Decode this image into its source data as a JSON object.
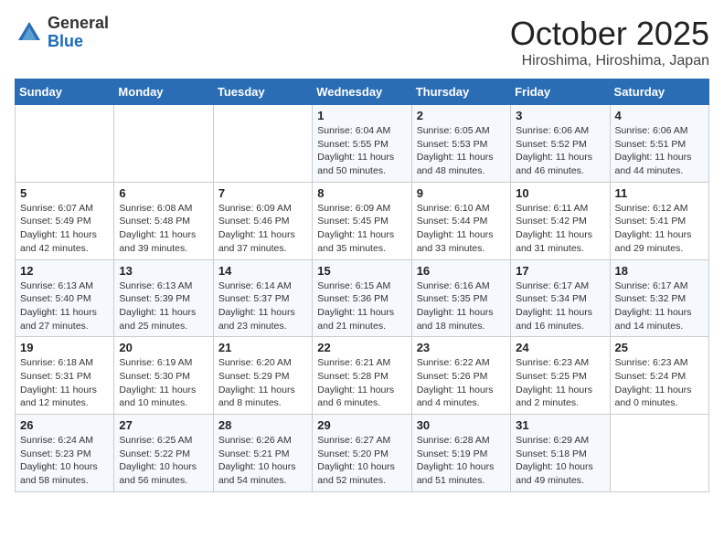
{
  "header": {
    "logo_general": "General",
    "logo_blue": "Blue",
    "month": "October 2025",
    "location": "Hiroshima, Hiroshima, Japan"
  },
  "weekdays": [
    "Sunday",
    "Monday",
    "Tuesday",
    "Wednesday",
    "Thursday",
    "Friday",
    "Saturday"
  ],
  "weeks": [
    [
      {
        "day": "",
        "text": ""
      },
      {
        "day": "",
        "text": ""
      },
      {
        "day": "",
        "text": ""
      },
      {
        "day": "1",
        "text": "Sunrise: 6:04 AM\nSunset: 5:55 PM\nDaylight: 11 hours\nand 50 minutes."
      },
      {
        "day": "2",
        "text": "Sunrise: 6:05 AM\nSunset: 5:53 PM\nDaylight: 11 hours\nand 48 minutes."
      },
      {
        "day": "3",
        "text": "Sunrise: 6:06 AM\nSunset: 5:52 PM\nDaylight: 11 hours\nand 46 minutes."
      },
      {
        "day": "4",
        "text": "Sunrise: 6:06 AM\nSunset: 5:51 PM\nDaylight: 11 hours\nand 44 minutes."
      }
    ],
    [
      {
        "day": "5",
        "text": "Sunrise: 6:07 AM\nSunset: 5:49 PM\nDaylight: 11 hours\nand 42 minutes."
      },
      {
        "day": "6",
        "text": "Sunrise: 6:08 AM\nSunset: 5:48 PM\nDaylight: 11 hours\nand 39 minutes."
      },
      {
        "day": "7",
        "text": "Sunrise: 6:09 AM\nSunset: 5:46 PM\nDaylight: 11 hours\nand 37 minutes."
      },
      {
        "day": "8",
        "text": "Sunrise: 6:09 AM\nSunset: 5:45 PM\nDaylight: 11 hours\nand 35 minutes."
      },
      {
        "day": "9",
        "text": "Sunrise: 6:10 AM\nSunset: 5:44 PM\nDaylight: 11 hours\nand 33 minutes."
      },
      {
        "day": "10",
        "text": "Sunrise: 6:11 AM\nSunset: 5:42 PM\nDaylight: 11 hours\nand 31 minutes."
      },
      {
        "day": "11",
        "text": "Sunrise: 6:12 AM\nSunset: 5:41 PM\nDaylight: 11 hours\nand 29 minutes."
      }
    ],
    [
      {
        "day": "12",
        "text": "Sunrise: 6:13 AM\nSunset: 5:40 PM\nDaylight: 11 hours\nand 27 minutes."
      },
      {
        "day": "13",
        "text": "Sunrise: 6:13 AM\nSunset: 5:39 PM\nDaylight: 11 hours\nand 25 minutes."
      },
      {
        "day": "14",
        "text": "Sunrise: 6:14 AM\nSunset: 5:37 PM\nDaylight: 11 hours\nand 23 minutes."
      },
      {
        "day": "15",
        "text": "Sunrise: 6:15 AM\nSunset: 5:36 PM\nDaylight: 11 hours\nand 21 minutes."
      },
      {
        "day": "16",
        "text": "Sunrise: 6:16 AM\nSunset: 5:35 PM\nDaylight: 11 hours\nand 18 minutes."
      },
      {
        "day": "17",
        "text": "Sunrise: 6:17 AM\nSunset: 5:34 PM\nDaylight: 11 hours\nand 16 minutes."
      },
      {
        "day": "18",
        "text": "Sunrise: 6:17 AM\nSunset: 5:32 PM\nDaylight: 11 hours\nand 14 minutes."
      }
    ],
    [
      {
        "day": "19",
        "text": "Sunrise: 6:18 AM\nSunset: 5:31 PM\nDaylight: 11 hours\nand 12 minutes."
      },
      {
        "day": "20",
        "text": "Sunrise: 6:19 AM\nSunset: 5:30 PM\nDaylight: 11 hours\nand 10 minutes."
      },
      {
        "day": "21",
        "text": "Sunrise: 6:20 AM\nSunset: 5:29 PM\nDaylight: 11 hours\nand 8 minutes."
      },
      {
        "day": "22",
        "text": "Sunrise: 6:21 AM\nSunset: 5:28 PM\nDaylight: 11 hours\nand 6 minutes."
      },
      {
        "day": "23",
        "text": "Sunrise: 6:22 AM\nSunset: 5:26 PM\nDaylight: 11 hours\nand 4 minutes."
      },
      {
        "day": "24",
        "text": "Sunrise: 6:23 AM\nSunset: 5:25 PM\nDaylight: 11 hours\nand 2 minutes."
      },
      {
        "day": "25",
        "text": "Sunrise: 6:23 AM\nSunset: 5:24 PM\nDaylight: 11 hours\nand 0 minutes."
      }
    ],
    [
      {
        "day": "26",
        "text": "Sunrise: 6:24 AM\nSunset: 5:23 PM\nDaylight: 10 hours\nand 58 minutes."
      },
      {
        "day": "27",
        "text": "Sunrise: 6:25 AM\nSunset: 5:22 PM\nDaylight: 10 hours\nand 56 minutes."
      },
      {
        "day": "28",
        "text": "Sunrise: 6:26 AM\nSunset: 5:21 PM\nDaylight: 10 hours\nand 54 minutes."
      },
      {
        "day": "29",
        "text": "Sunrise: 6:27 AM\nSunset: 5:20 PM\nDaylight: 10 hours\nand 52 minutes."
      },
      {
        "day": "30",
        "text": "Sunrise: 6:28 AM\nSunset: 5:19 PM\nDaylight: 10 hours\nand 51 minutes."
      },
      {
        "day": "31",
        "text": "Sunrise: 6:29 AM\nSunset: 5:18 PM\nDaylight: 10 hours\nand 49 minutes."
      },
      {
        "day": "",
        "text": ""
      }
    ]
  ]
}
